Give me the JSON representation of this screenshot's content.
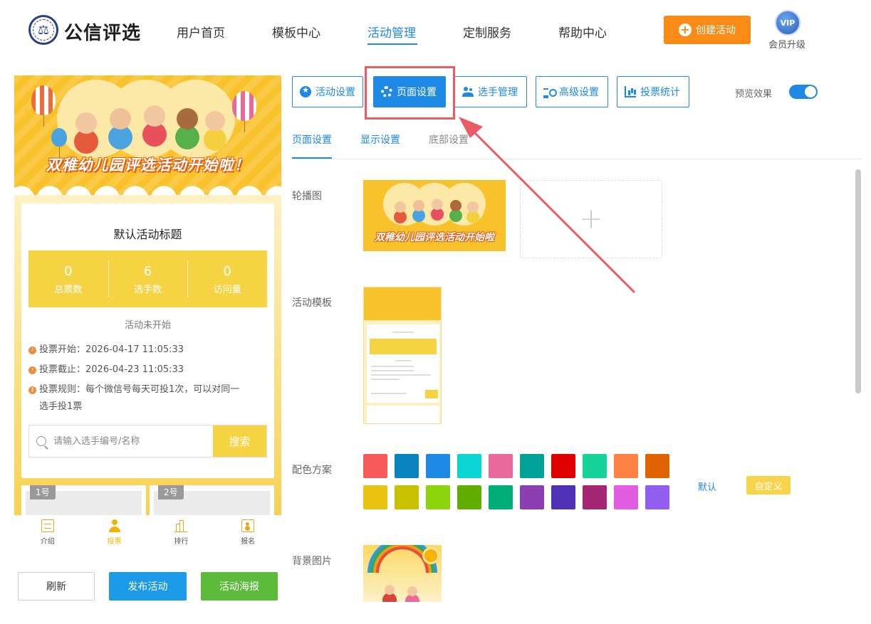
{
  "header": {
    "logo_emblem": "⚖",
    "logo_text": "公信评选",
    "nav": [
      "用户首页",
      "模板中心",
      "活动管理",
      "定制服务",
      "帮助中心"
    ],
    "create_button": "创建活动",
    "vip_badge": "VIP",
    "vip_label": "会员升级"
  },
  "preview": {
    "banner_title": "双稚幼儿园评选活动开始啦！",
    "activity_title": "默认活动标题",
    "stats": [
      {
        "value": "0",
        "label": "总票数"
      },
      {
        "value": "6",
        "label": "选手数"
      },
      {
        "value": "0",
        "label": "访问量"
      }
    ],
    "status": "活动未开始",
    "vote_start": "投票开始：2026-04-17 11:05:33",
    "vote_end": "投票截止：2026-04-23 11:05:33",
    "vote_rule": "投票规则：每个微信号每天可投1次，可以对同一选手投1票",
    "search_placeholder": "请输入选手编号/名称",
    "search_button": "搜索",
    "players": [
      "1号",
      "2号"
    ],
    "tabs": [
      "介绍",
      "投票",
      "排行",
      "报名"
    ]
  },
  "actions": {
    "refresh": "刷新",
    "publish": "发布活动",
    "poster": "活动海报"
  },
  "toolbar": {
    "buttons": [
      "活动设置",
      "页面设置",
      "选手管理",
      "高级设置",
      "投票统计"
    ],
    "preview_label": "预览效果"
  },
  "subtabs": [
    "页面设置",
    "显示设置",
    "底部设置"
  ],
  "form": {
    "carousel_label": "轮播图",
    "carousel_image_title": "双稚幼儿园评选活动开始啦",
    "upload_plus": "+",
    "template_label": "活动模板",
    "color_label": "配色方案",
    "colors_row1": [
      "#f65a5a",
      "#0a82c0",
      "#1e88e5",
      "#0ad4d4",
      "#e8699a",
      "#00a196",
      "#e00000",
      "#16d39a",
      "#ff8041",
      "#e06200"
    ],
    "colors_row2": [
      "#e8c30f",
      "#c8c100",
      "#8ed40d",
      "#60ad00",
      "#00af78",
      "#8b3fb0",
      "#5032b6",
      "#a52672",
      "#e25de1",
      "#915ef0"
    ],
    "color_default": "默认",
    "color_custom": "自定义",
    "bg_label": "背景图片"
  },
  "colors": {
    "primary": "#1e88e5",
    "orange": "#fa8c16",
    "yellow": "#f6d342",
    "highlight": "#ec5a63"
  }
}
